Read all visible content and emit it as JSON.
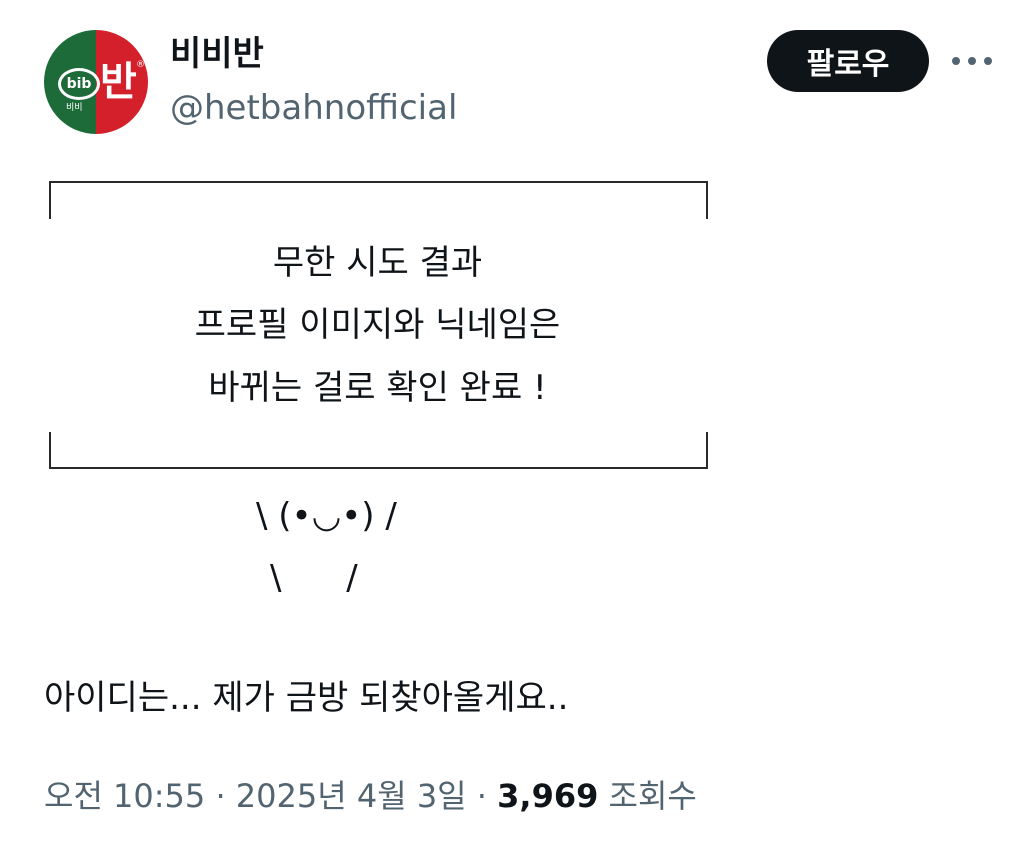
{
  "profile": {
    "display_name": "비비반",
    "handle": "@hetbahnofficial",
    "avatar": {
      "logo_text_left": "bib",
      "logo_text_sub": "비비",
      "logo_text_right": "반",
      "logo_mark": "®",
      "colors": {
        "left": "#1e6b3a",
        "right": "#d3202a"
      }
    }
  },
  "actions": {
    "follow_label": "팔로우",
    "more_icon": "more-horizontal-icon"
  },
  "tweet": {
    "box_lines": [
      "무한 시도 결과",
      "프로필 이미지와 닉네임은",
      "바뀌는 걸로 확인 완료 !"
    ],
    "kaomoji_lines": [
      "\\ (•◡•) /",
      "\\      /"
    ],
    "text": "아이디는... 제가 금방 되찾아올게요..",
    "time": "오전 10:55",
    "separator": "·",
    "date": "2025년 4월 3일",
    "views_count": "3,969",
    "views_label": "조회수"
  },
  "colors": {
    "text_primary": "#0f1419",
    "text_secondary": "#536471",
    "button_bg": "#0f1419"
  }
}
